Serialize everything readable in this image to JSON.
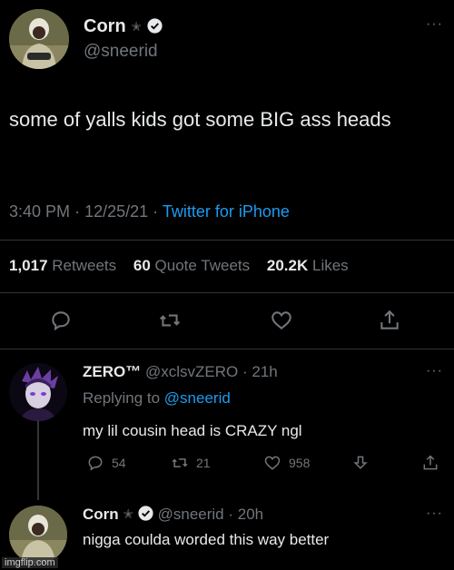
{
  "main_tweet": {
    "display_name": "Corn",
    "badge_star": "✭",
    "handle": "@sneerid",
    "text": "some of yalls kids got some BIG ass heads",
    "time": "3:40 PM",
    "date": "12/25/21",
    "source": "Twitter for iPhone",
    "retweets_count": "1,017",
    "retweets_label": "Retweets",
    "quotes_count": "60",
    "quotes_label": "Quote Tweets",
    "likes_count": "20.2K",
    "likes_label": "Likes",
    "more_label": "···"
  },
  "reply1": {
    "display_name": "ZERO™",
    "handle": "@xclsvZERO",
    "age": "21h",
    "replying_label": "Replying to",
    "replying_to": "@sneerid",
    "text": "my lil cousin head is CRAZY ngl",
    "reply_count": "54",
    "retweet_count": "21",
    "like_count": "958",
    "more_label": "···"
  },
  "reply2": {
    "display_name": "Corn",
    "badge_star": "✭",
    "handle": "@sneerid",
    "age": "20h",
    "text": "nigga coulda worded this way better",
    "more_label": "···"
  },
  "watermark": "imgflip.com",
  "icons": [
    "reply-icon",
    "retweet-icon",
    "like-icon",
    "share-icon",
    "verified-icon",
    "download-icon"
  ],
  "colors": {
    "background": "#000000",
    "text": "#e7e9ea",
    "muted": "#71767b",
    "accent": "#1d9bf0"
  }
}
